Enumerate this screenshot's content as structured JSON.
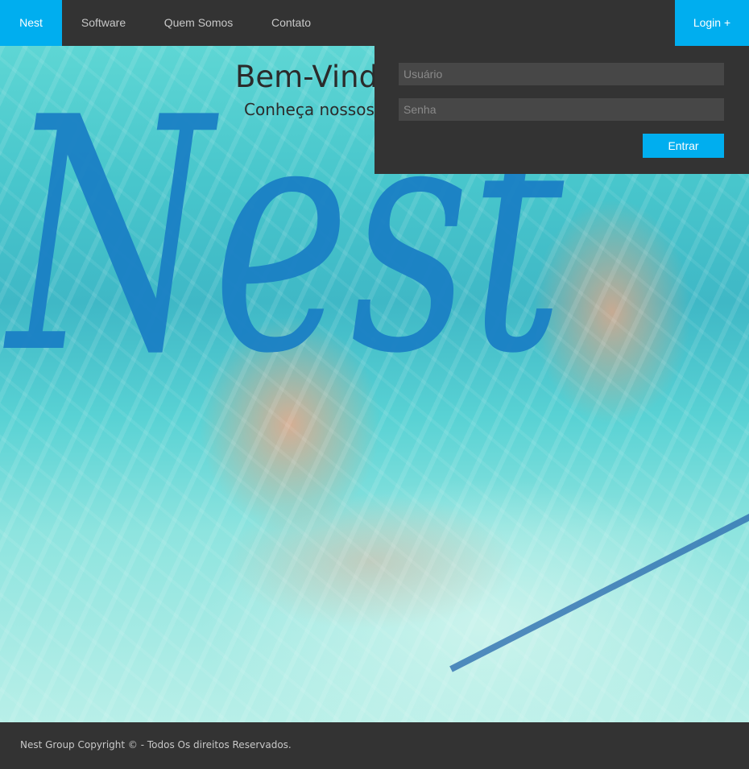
{
  "nav": {
    "brand": "Nest",
    "items": [
      {
        "label": "Software"
      },
      {
        "label": "Quem Somos"
      },
      {
        "label": "Contato"
      }
    ],
    "login_label": "Login +"
  },
  "hero": {
    "logo_text": "Nest",
    "title": "Bem-Vind",
    "subtitle": "Conheça nossos"
  },
  "login_form": {
    "username_placeholder": "Usuário",
    "password_placeholder": "Senha",
    "submit_label": "Entrar"
  },
  "footer": {
    "text": "Nest Group Copyright © - Todos Os direitos Reservados."
  },
  "colors": {
    "accent": "#00aeef",
    "bar": "#333333",
    "logo_blue": "#1a7fc4"
  }
}
